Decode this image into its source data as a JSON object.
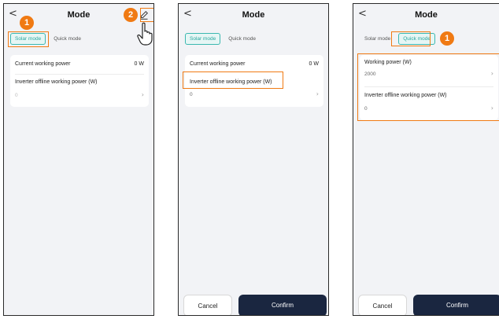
{
  "screen1": {
    "back": "<",
    "title": "Mode",
    "tabs": [
      "Solar mode",
      "Quick mode"
    ],
    "rows": [
      {
        "label": "Current working power",
        "value": "0 W"
      },
      {
        "label": "Inverter offline working power (W)",
        "value": "0"
      }
    ],
    "badges": [
      "1",
      "2"
    ]
  },
  "screen2": {
    "back": "<",
    "title": "Mode",
    "tabs": [
      "Solar mode",
      "Quick mode"
    ],
    "rows": [
      {
        "label": "Current working power",
        "value": "0 W"
      },
      {
        "label": "Inverter offline working power (W)",
        "value": "0"
      }
    ],
    "cancel": "Cancel",
    "confirm": "Confirm"
  },
  "screen3": {
    "back": "<",
    "title": "Mode",
    "tabs": [
      "Solar mode",
      "Quick mode"
    ],
    "rows": [
      {
        "label": "Working power (W)",
        "value": "2000"
      },
      {
        "label": "Inverter offline working power (W)",
        "value": "0"
      }
    ],
    "badge": "1",
    "cancel": "Cancel",
    "confirm": "Confirm"
  },
  "colors": {
    "highlight": "#f07a13",
    "tab_active": "#3bb8b0",
    "confirm_bg": "#1a2640"
  },
  "icons": [
    "chevron-left-icon",
    "edit-pencil-icon",
    "hand-pointer-icon",
    "chevron-right-icon"
  ]
}
